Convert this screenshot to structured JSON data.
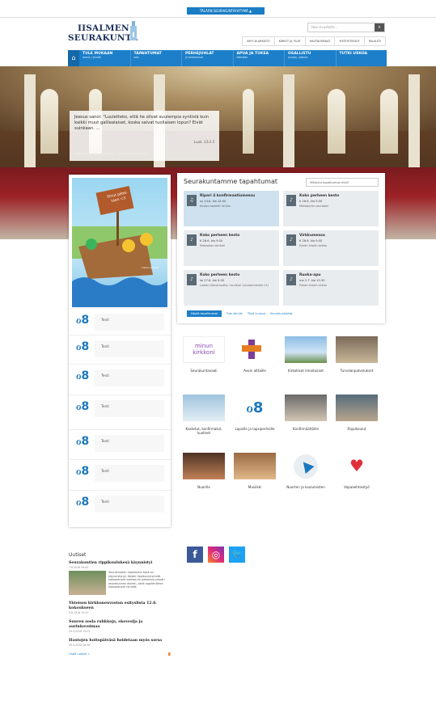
{
  "topbar": {
    "toggle_label": "TÄLÄÄN SEURAKUNTAYHTYMÄ ▲"
  },
  "logo": {
    "line1": "IISALMEN",
    "line2": "SEURAKUNTA"
  },
  "search": {
    "placeholder": "Hae sivustolta..."
  },
  "util_links": [
    "INFO JA ARKISTO",
    "KIRKOT JA TILAT",
    "HAUTAUSMAAT",
    "YHTEYSTIEDOT",
    "PALAUTE"
  ],
  "nav": [
    {
      "label": "TULE MUKAAN",
      "sub": "lamut, ryhmät"
    },
    {
      "label": "TAPAHTUMAT",
      "sub": "kalu"
    },
    {
      "label": "PERHEJUHLAT",
      "sub": "ja toimitukset"
    },
    {
      "label": "APUA JA TUKEA",
      "sub": "elämään"
    },
    {
      "label": "OSALLISTU",
      "sub": "avusta, vaikuta"
    },
    {
      "label": "TUTKI USKOA",
      "sub": ""
    }
  ],
  "quote": {
    "text": "Jeesus sanoi: \"Luuletteko, että he olivat suurempia syntisiä kuin kaikki muut galilealaiset, koska saivat tuollaisen lopun? Eivät suinkaan. ...",
    "source": "Luuk. 13:2-3",
    "links": [
      "Raamattu",
      "Evankeliumi",
      "Jumalanpalvelukset"
    ]
  },
  "poster": {
    "sign": "Sinut pöhti- taan <3",
    "credit": "rotovir Jokilehti"
  },
  "quicklinks": [
    "Testi",
    "Testi",
    "Testi",
    "Testi",
    "Testi",
    "Testi",
    "Testi"
  ],
  "events": {
    "title": "Seurakuntamme tapahtumat",
    "filter": "Millaista tapahtumaa etsit?",
    "items": [
      {
        "title": "Ripari 4 konfirmaatiomessu",
        "date": "su 24.6. klo 14.00",
        "place": "Kustaa Aadolfin kirkko",
        "icon": "♫"
      },
      {
        "title": "Koko perheen kesto",
        "date": "ti 26.6. klo 9.00",
        "place": "Metsäpirtin seurakoti",
        "icon": "♪"
      },
      {
        "title": "Koko perheen kesto",
        "date": "ti 26.6. klo 9.00",
        "place": "Peltosalon leirikoti",
        "icon": "♪"
      },
      {
        "title": "Virkkumessu",
        "date": "ti 26.6. klo 9.00",
        "place": "Pyhän Eeskin kirkko",
        "icon": "♪"
      },
      {
        "title": "Koko perheen kesto",
        "date": "ke 27.6. klo 9.00",
        "place": "Laatan Iltaromuutila, Laurikari (Lauremmentie 11)",
        "icon": "♪"
      },
      {
        "title": "Ruoka-apu",
        "date": "ma 2.7. klo 10.30",
        "place": "Pyhän Eeskin kirkko",
        "icon": "♪"
      }
    ],
    "btn": "Näytä tapahtumat",
    "links": [
      "Tulo alkulle",
      "Tänä kuussa",
      "Seurakuntatilat"
    ]
  },
  "tiles": [
    {
      "label": "Seurakuntavaali",
      "img": "minun kirkkoni"
    },
    {
      "label": "Avoin alttaille",
      "img": "cross"
    },
    {
      "label": "Kirkolliset ilmoitukset",
      "img": "photo"
    },
    {
      "label": "Turvalanpalvelukset",
      "img": "photo"
    },
    {
      "label": "Kastetut, konfirmatut, kuolleet",
      "img": "photo"
    },
    {
      "label": "Lapsille ja lapsiperheille",
      "img": "figure"
    },
    {
      "label": "Konfirmäältäille",
      "img": "photo"
    },
    {
      "label": "Rippikoulut",
      "img": "photo"
    },
    {
      "label": "Nuorille",
      "img": "photo"
    },
    {
      "label": "Musiikki",
      "img": "photo"
    },
    {
      "label": "Nuorten ja koululaisten",
      "img": "arrow"
    },
    {
      "label": "Vapaaehtoistyö",
      "img": "heart"
    }
  ],
  "news": {
    "heading": "Uutiset",
    "items": [
      {
        "title": "Seurakuntien rippikoulukesä käynnistyi",
        "date": "7.6.2018 09:00",
        "text": "Seurakuntien rippikoulut kesä on käynnistynyt. Kesän rippikouluryhmät kokoontuvat useissa eri paikoissa ympäri seurakunnan alueen, sekä rippileirilleen kokoontuvat ryhmät."
      },
      {
        "title": "Yhteisen kirkkoneuvoston esityslista 12.6. kokoukseen",
        "date": "5.6.2018 15:47",
        "text": ""
      },
      {
        "title": "Suuren sosla ruhkkoja, ekovesija ja aurinkovoimaa",
        "date": "29.5.2018 15:02",
        "text": ""
      },
      {
        "title": "Hautojen hoitopäiväsä hoidetaan myös sorsa",
        "date": "29.5.2018 09:58",
        "text": ""
      }
    ],
    "more": "Lisää uutisia »"
  },
  "social": [
    "facebook",
    "instagram",
    "twitter"
  ]
}
